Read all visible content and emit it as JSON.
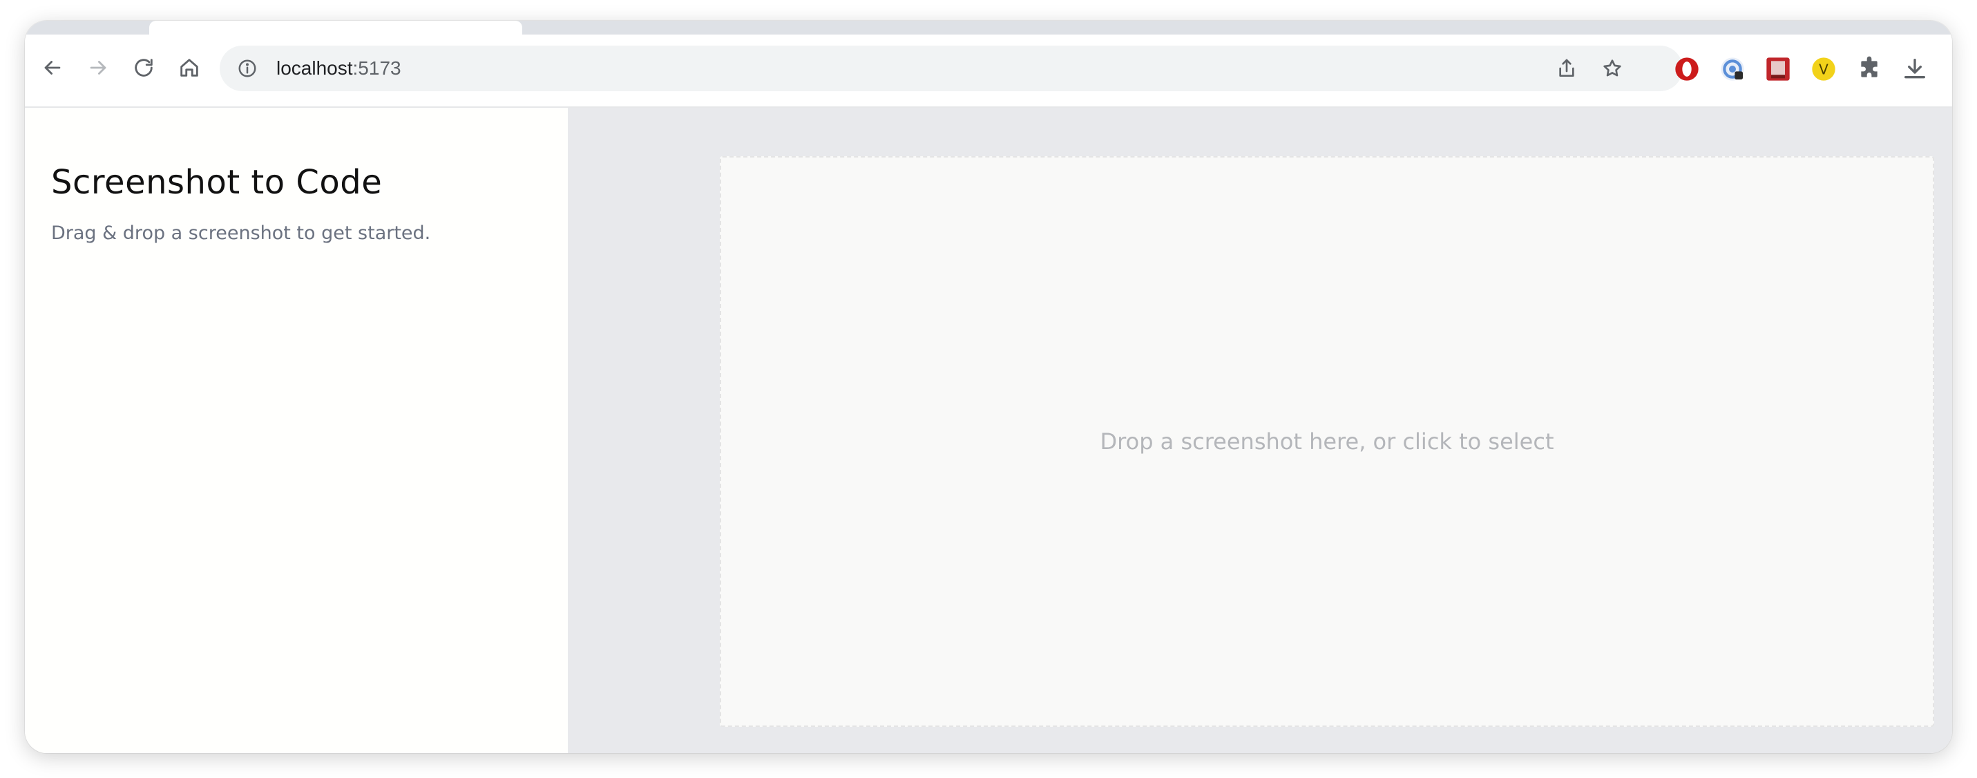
{
  "browser": {
    "url_host": "localhost",
    "url_port": ":5173",
    "toolbar_icons": [
      "back-icon",
      "forward-icon",
      "reload-icon",
      "home-icon",
      "info-icon",
      "share-icon",
      "bookmark-star-icon",
      "extensions-icon",
      "download-icon"
    ],
    "extensions": [
      {
        "name": "opera-extension-icon",
        "color": "#cc1c1c"
      },
      {
        "name": "privacy-extension-icon",
        "color": "#5b8fd8"
      },
      {
        "name": "image-extension-icon",
        "color": "#c0262b"
      },
      {
        "name": "v-extension-icon",
        "color": "#f2d21a",
        "letter": "V"
      }
    ]
  },
  "sidebar": {
    "title": "Screenshot to Code",
    "subtitle": "Drag & drop a screenshot to get started."
  },
  "main": {
    "dropzone_text": "Drop a screenshot here, or click to select"
  },
  "colors": {
    "sidebar_bg": "#fffffd",
    "main_bg": "#e8e9ec",
    "dropzone_bg": "#f9f9f8",
    "dropzone_text": "#b4b6ba",
    "title_text": "#111111",
    "subtitle_text": "#6b7280"
  }
}
